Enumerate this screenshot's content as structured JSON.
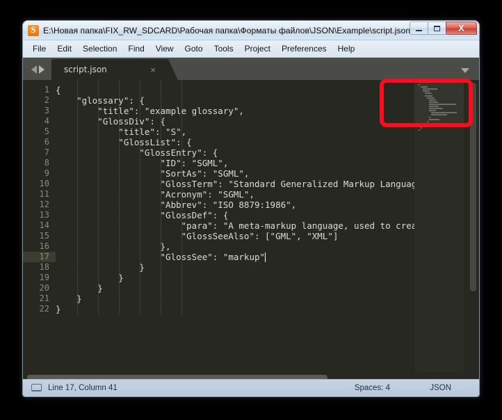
{
  "window": {
    "title": "E:\\Новая папка\\FIX_RW_SDCARD\\Рабочая папка\\Форматы файлов\\JSON\\Example\\script.json...",
    "app_icon": "sublime-text-icon",
    "buttons": {
      "minimize": "Minimize",
      "maximize": "Maximize",
      "close": "X"
    }
  },
  "menubar": {
    "items": [
      {
        "label": "File"
      },
      {
        "label": "Edit"
      },
      {
        "label": "Selection"
      },
      {
        "label": "Find"
      },
      {
        "label": "View"
      },
      {
        "label": "Goto"
      },
      {
        "label": "Tools"
      },
      {
        "label": "Project"
      },
      {
        "label": "Preferences"
      },
      {
        "label": "Help"
      }
    ]
  },
  "tabbar": {
    "prev_icon": "arrow-left-icon",
    "next_icon": "arrow-right-icon",
    "tabs": [
      {
        "label": "script.json",
        "close_glyph": "×",
        "active": true
      }
    ],
    "overflow_icon": "chevron-down-icon"
  },
  "editor": {
    "active_line": 17,
    "caret_line": 17,
    "caret_column": 41,
    "lines": [
      {
        "n": 1,
        "text": "{"
      },
      {
        "n": 2,
        "text": "    \"glossary\": {"
      },
      {
        "n": 3,
        "text": "        \"title\": \"example glossary\","
      },
      {
        "n": 4,
        "text": "        \"GlossDiv\": {"
      },
      {
        "n": 5,
        "text": "            \"title\": \"S\","
      },
      {
        "n": 6,
        "text": "            \"GlossList\": {"
      },
      {
        "n": 7,
        "text": "                \"GlossEntry\": {"
      },
      {
        "n": 8,
        "text": "                    \"ID\": \"SGML\","
      },
      {
        "n": 9,
        "text": "                    \"SortAs\": \"SGML\","
      },
      {
        "n": 10,
        "text": "                    \"GlossTerm\": \"Standard Generalized Markup Language\","
      },
      {
        "n": 11,
        "text": "                    \"Acronym\": \"SGML\","
      },
      {
        "n": 12,
        "text": "                    \"Abbrev\": \"ISO 8879:1986\","
      },
      {
        "n": 13,
        "text": "                    \"GlossDef\": {"
      },
      {
        "n": 14,
        "text": "                        \"para\": \"A meta-markup language, used to create m"
      },
      {
        "n": 15,
        "text": "                        \"GlossSeeAlso\": [\"GML\", \"XML\"]"
      },
      {
        "n": 16,
        "text": "                    },"
      },
      {
        "n": 17,
        "text": "                    \"GlossSee\": \"markup\""
      },
      {
        "n": 18,
        "text": "                }"
      },
      {
        "n": 19,
        "text": "            }"
      },
      {
        "n": 20,
        "text": "        }"
      },
      {
        "n": 21,
        "text": "    }"
      },
      {
        "n": 22,
        "text": "}"
      }
    ]
  },
  "statusbar": {
    "icon": "console-icon",
    "position": "Line 17, Column 41",
    "indentation": "Spaces: 4",
    "syntax": "JSON"
  },
  "annotation": {
    "shape": "rounded-rectangle",
    "color": "#fc0d1b",
    "target": "minimap"
  },
  "colors": {
    "editor_background": "#272822",
    "active_line": "#3e3d32",
    "code_text": "#dcdcd2",
    "gutter_text": "#8a8a80",
    "tabbar": "#4b4b47",
    "annotation_red": "#fc0d1b"
  }
}
